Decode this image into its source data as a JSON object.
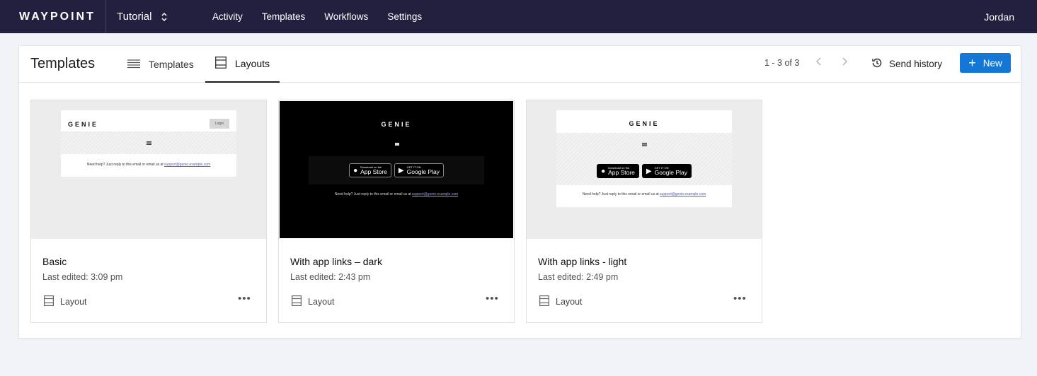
{
  "topbar": {
    "brand": "WAYPOINT",
    "project": "Tutorial",
    "nav": [
      "Activity",
      "Templates",
      "Workflows",
      "Settings"
    ],
    "user": "Jordan"
  },
  "header": {
    "title": "Templates",
    "tabs": [
      {
        "label": "Templates",
        "icon": "list-icon",
        "active": false
      },
      {
        "label": "Layouts",
        "icon": "layout-icon",
        "active": true
      }
    ],
    "pagination": "1 - 3 of 3",
    "send_history": "Send history",
    "new_button": "New"
  },
  "cards": [
    {
      "name": "Basic",
      "edited": "Last edited: 3:09 pm",
      "type": "Layout",
      "preview": {
        "logo": "GENIE",
        "login": "Login",
        "footer_text": "Need help? Just reply to this email or email us at ",
        "footer_link": "support@genie.example.com"
      }
    },
    {
      "name": "With app links – dark",
      "edited": "Last edited: 2:43 pm",
      "type": "Layout",
      "preview": {
        "logo": "GENIE",
        "appstore_small": "Download on the",
        "appstore_big": "App Store",
        "play_small": "GET IT ON",
        "play_big": "Google Play",
        "footer_text": "Need help? Just reply to this email or email us at ",
        "footer_link": "support@genie.example.com"
      }
    },
    {
      "name": "With app links - light",
      "edited": "Last edited: 2:49 pm",
      "type": "Layout",
      "preview": {
        "logo": "GENIE",
        "appstore_small": "Download on the",
        "appstore_big": "App Store",
        "play_small": "GET IT ON",
        "play_big": "Google Play",
        "footer_text": "Need help? Just reply to this email or email us at ",
        "footer_link": "support@genie.example.com"
      }
    }
  ],
  "colors": {
    "topbar": "#23203f",
    "accent": "#1477d6",
    "page_bg": "#f1f3f6"
  }
}
